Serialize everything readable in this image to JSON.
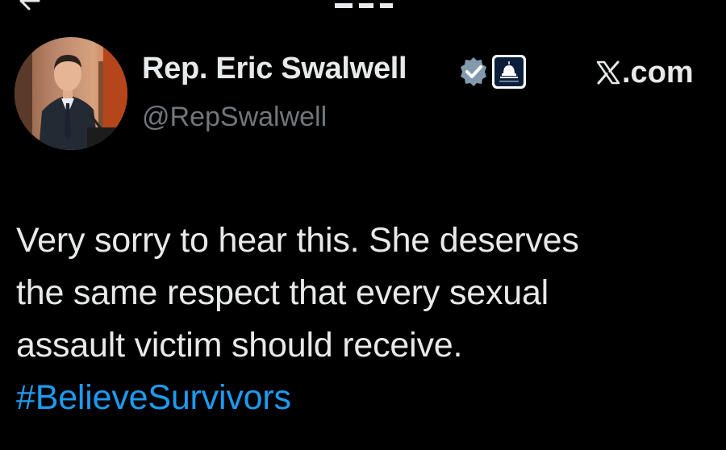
{
  "author": {
    "display_name": "Rep. Eric Swalwell",
    "handle": "@RepSwalwell",
    "avatar_icon": "profile-photo",
    "verified_icon": "verified-badge-icon",
    "verified_color": "#829aab",
    "affiliate_icon": "capitol-dome-icon",
    "affiliate_bg": "#0b1e3a"
  },
  "watermark": {
    "logo_icon": "x-logo-icon",
    "text": ".com"
  },
  "tweet": {
    "lines": [
      "Very sorry to hear this. She deserves",
      "the same respect that every sexual",
      "assault victim should receive."
    ],
    "hashtag": "#BelieveSurvivors",
    "hashtag_color": "#1d9bf0"
  },
  "colors": {
    "background": "#000000",
    "primary_text": "#e7e9ea",
    "secondary_text": "#71767b"
  }
}
